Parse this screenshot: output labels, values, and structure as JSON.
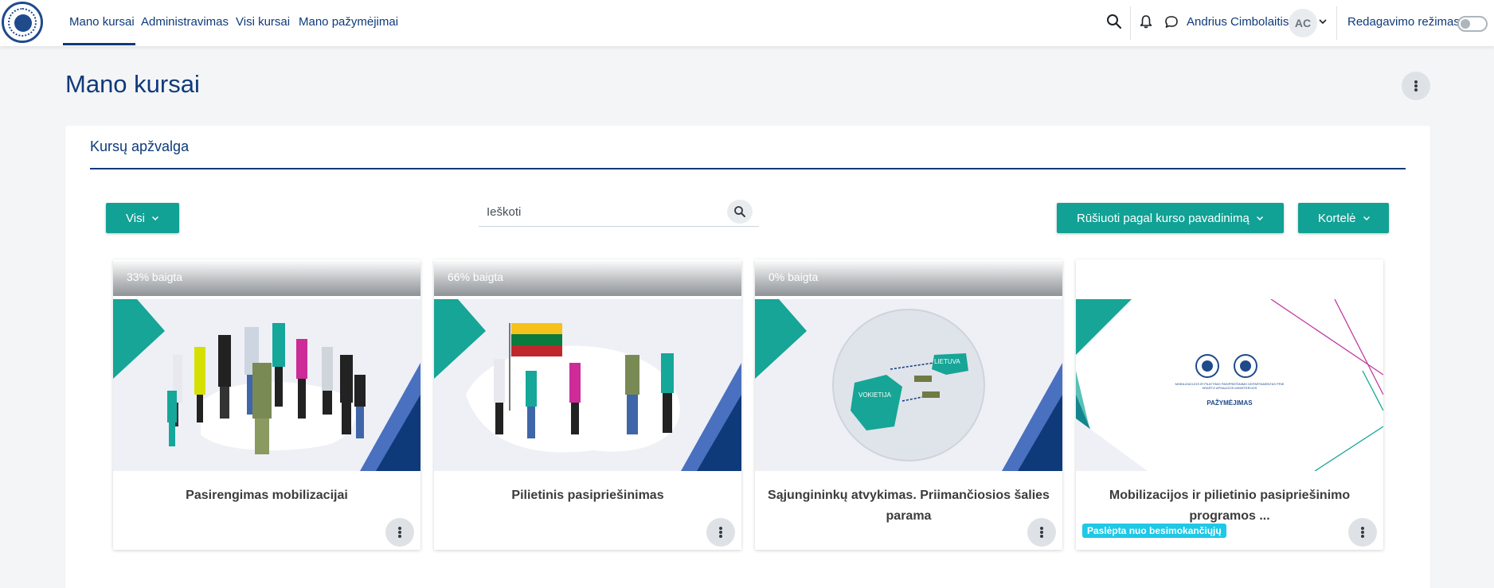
{
  "nav": {
    "links": [
      "Mano kursai",
      "Administravimas",
      "Visi kursai",
      "Mano pažymėjimai"
    ],
    "user_name": "Andrius Cimbolaitis",
    "avatar_initials": "AC",
    "edit_mode_label": "Redagavimo režimas"
  },
  "page": {
    "title": "Mano kursai"
  },
  "overview": {
    "title": "Kursų apžvalga",
    "filter_label": "Visi",
    "search_placeholder": "Ieškoti",
    "sort_label": "Rūšiuoti pagal kurso pavadinimą",
    "view_label": "Kortelė"
  },
  "courses": [
    {
      "progress": "33% baigta",
      "name": "Pasirengimas mobilizacijai"
    },
    {
      "progress": "66% baigta",
      "name": "Pilietinis pasipriešinimas"
    },
    {
      "progress": "0% baigta",
      "name": "Sąjungininkų atvykimas. Priimančiosios šalies parama",
      "map_label_1": "LIETUVA",
      "map_label_2": "VOKIETIJA"
    },
    {
      "progress": "",
      "name": "Mobilizacijos ir pilietinio pasipriešinimo programos ...",
      "badge": "Paslėpta nuo besimokančiųjų",
      "cert_small": "MOBILIZACIJOS IR PILIETINIO PASIPRIEŠINIMO DEPARTAMENTAS PRIE KRAŠTO APSAUGOS MINISTERIJOS",
      "cert_title": "PAŽYMĖJIMAS"
    }
  ],
  "colors": {
    "brand": "#0f3a7a",
    "accent": "#12a195",
    "badge": "#1ec8e6"
  }
}
